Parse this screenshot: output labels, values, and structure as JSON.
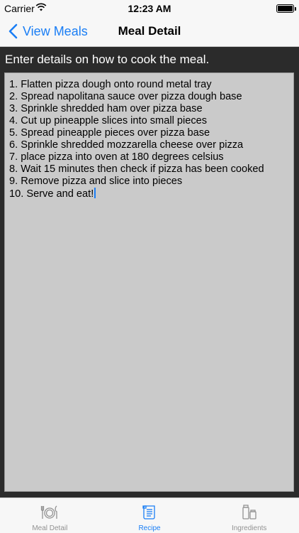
{
  "status_bar": {
    "carrier": "Carrier",
    "time": "12:23 AM"
  },
  "nav": {
    "back_label": "View Meals",
    "title": "Meal Detail"
  },
  "instruction": "Enter details on how to cook the meal.",
  "recipe_steps": [
    "1. Flatten pizza dough onto round metal tray",
    "2. Spread napolitana sauce over pizza dough base",
    "3. Sprinkle shredded ham over pizza base",
    "4. Cut up pineapple slices into small pieces",
    "5. Spread pineapple pieces over pizza base",
    "6. Sprinkle shredded mozzarella cheese over pizza",
    "7. place pizza into oven at 180 degrees celsius",
    "8. Wait 15 minutes then check if pizza has been cooked",
    "9. Remove pizza and slice into pieces",
    "10. Serve and eat!"
  ],
  "tabs": [
    {
      "label": "Meal Detail",
      "icon": "plate-utensils-icon",
      "active": false
    },
    {
      "label": "Recipe",
      "icon": "scroll-icon",
      "active": true
    },
    {
      "label": "Ingredients",
      "icon": "jars-icon",
      "active": false
    }
  ],
  "colors": {
    "accent": "#1a7ef5",
    "background": "#2b2b2b",
    "text_area": "#cacaca",
    "inactive_tab": "#929292"
  }
}
